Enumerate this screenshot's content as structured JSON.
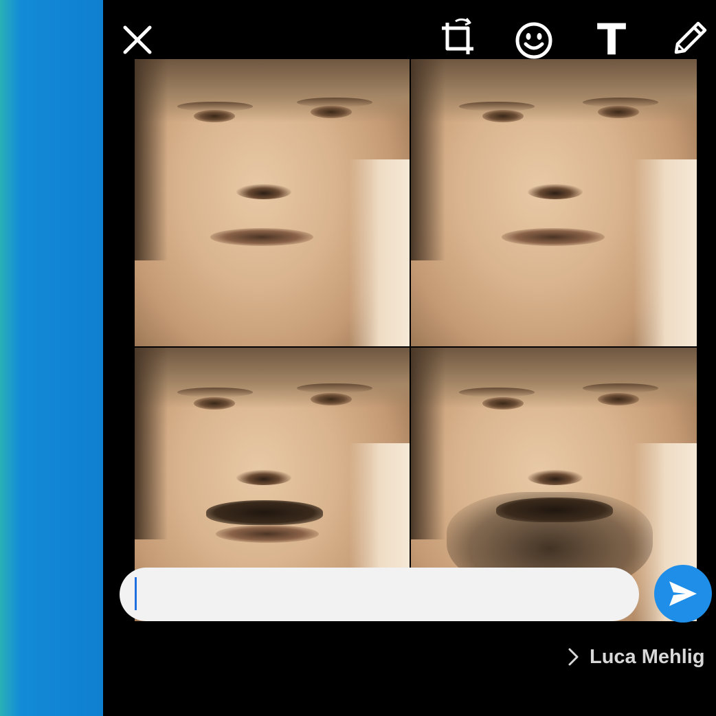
{
  "toolbar": {
    "close_icon": "close-icon",
    "crop_rotate_icon": "crop-rotate-icon",
    "emoji_icon": "emoji-icon",
    "text_tool_label": "T",
    "draw_icon": "pencil-icon"
  },
  "composer": {
    "caption_value": "",
    "send_icon": "send-icon"
  },
  "recipient": {
    "name": "Luca Mehlig"
  },
  "colors": {
    "accent": "#1f8ee8",
    "sidebar_gradient_start": "#28b0b4",
    "sidebar_gradient_end": "#0f7fd0",
    "editor_background": "#000000"
  }
}
